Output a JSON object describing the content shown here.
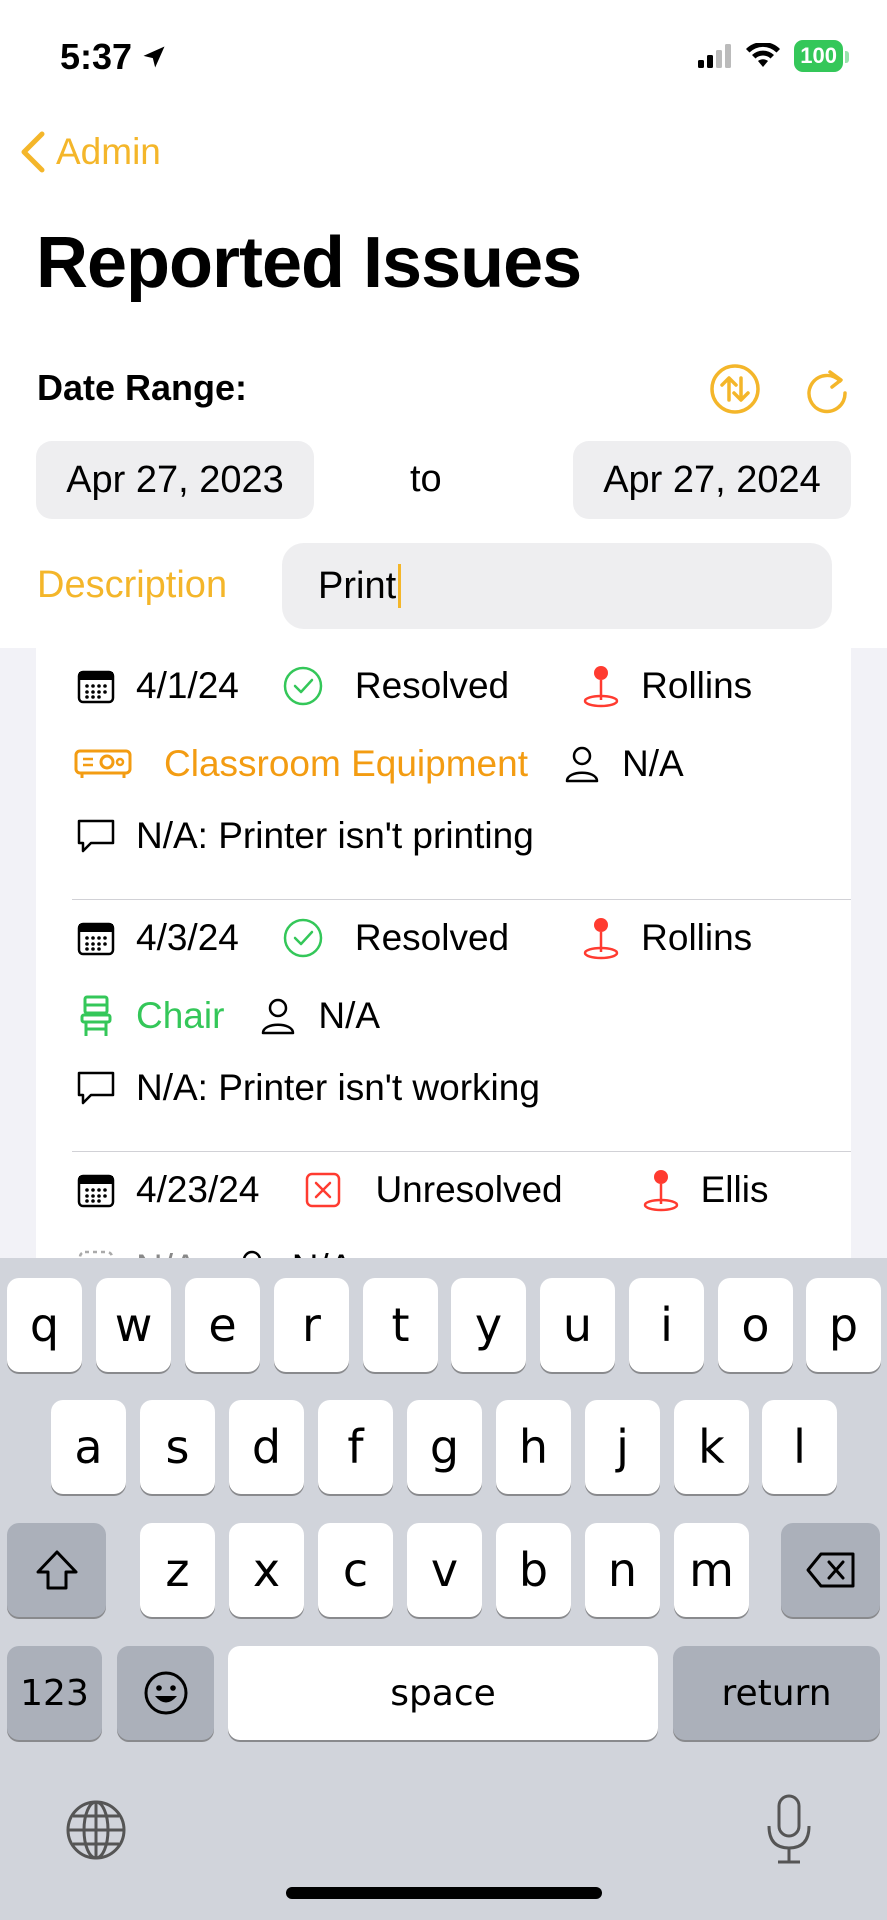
{
  "status": {
    "time": "5:37",
    "battery": "100"
  },
  "nav": {
    "back_label": "Admin",
    "title": "Reported Issues"
  },
  "filters": {
    "date_range_label": "Date Range:",
    "from_date": "Apr 27, 2023",
    "to_word": "to",
    "to_date": "Apr 27, 2024",
    "description_label": "Description",
    "description_value": "Print"
  },
  "colors": {
    "accent": "#f4b62a",
    "resolved": "#34c759",
    "unresolved": "#ff3b30",
    "category_equipment": "#f39c12",
    "category_chair": "#34c759"
  },
  "issues": [
    {
      "date": "4/1/24",
      "status": "Resolved",
      "location": "Rollins",
      "category": "Classroom Equipment",
      "category_icon": "projector-icon",
      "assignee": "N/A",
      "description": "N/A: Printer isn't printing"
    },
    {
      "date": "4/3/24",
      "status": "Resolved",
      "location": "Rollins",
      "category": "Chair",
      "category_icon": "chair-icon",
      "assignee": "N/A",
      "description": "N/A: Printer isn't working"
    },
    {
      "date": "4/23/24",
      "status": "Unresolved",
      "location": "Ellis",
      "category": "N/A",
      "category_icon": "dotted-box-icon",
      "assignee": "N/A",
      "description": ""
    }
  ],
  "keyboard": {
    "row1": [
      "q",
      "w",
      "e",
      "r",
      "t",
      "y",
      "u",
      "i",
      "o",
      "p"
    ],
    "row2": [
      "a",
      "s",
      "d",
      "f",
      "g",
      "h",
      "j",
      "k",
      "l"
    ],
    "row3": [
      "z",
      "x",
      "c",
      "v",
      "b",
      "n",
      "m"
    ],
    "numbers_label": "123",
    "space_label": "space",
    "return_label": "return"
  }
}
